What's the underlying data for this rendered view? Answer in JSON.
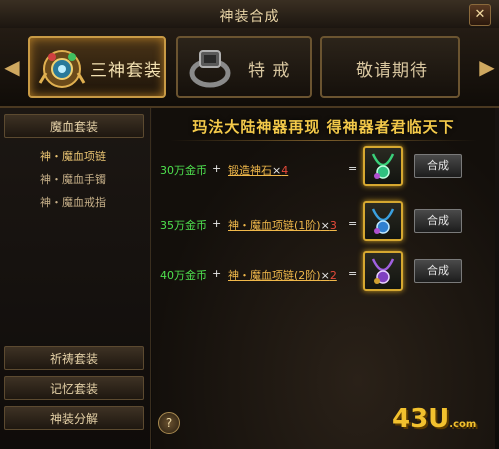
{
  "window": {
    "title": "神装合成",
    "close_label": "✕"
  },
  "tabs": [
    {
      "label": "三神套装",
      "icon": "amulet-icon",
      "active": true
    },
    {
      "label": "特 戒",
      "icon": "ring-icon",
      "active": false
    },
    {
      "label": "敬请期待",
      "icon": "",
      "active": false
    }
  ],
  "sidebar": {
    "category": "魔血套装",
    "sub_items": [
      "神・魔血项链",
      "神・魔血手镯",
      "神・魔血戒指"
    ],
    "active_sub": 0,
    "bottom_buttons": [
      "祈祷套装",
      "记忆套装",
      "神装分解"
    ]
  },
  "main": {
    "banner": "玛法大陆神器再现 得神器者君临天下",
    "recipes": [
      {
        "gold": "30万金币",
        "plus": "+",
        "item": "锻造神石",
        "times": "×",
        "qty": "4",
        "equals": "=",
        "result_icon": "green-necklace-icon",
        "button": "合成"
      },
      {
        "gold": "35万金币",
        "plus": "+",
        "item": "神・魔血项链(1阶)",
        "times": "×",
        "qty": "3",
        "equals": "=",
        "result_icon": "blue-necklace-icon",
        "button": "合成"
      },
      {
        "gold": "40万金币",
        "plus": "+",
        "item": "神・魔血项链(2阶)",
        "times": "×",
        "qty": "2",
        "equals": "=",
        "result_icon": "purple-necklace-icon",
        "button": "合成"
      }
    ],
    "help_label": "?",
    "logo_text": "43U",
    "logo_suffix": ".com"
  },
  "colors": {
    "gold_text": "#4ee04e",
    "item_text": "#f0b84a",
    "qty_text": "#e84a3a",
    "banner": "#f3c94a",
    "slot_border": "#d6a830"
  }
}
